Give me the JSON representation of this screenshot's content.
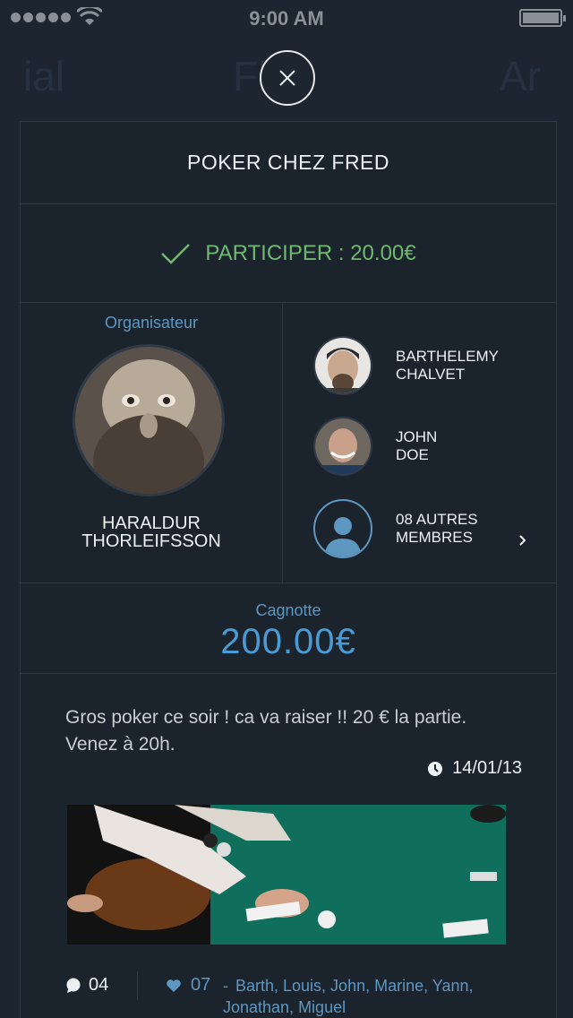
{
  "status_bar": {
    "time": "9:00 AM"
  },
  "background_nav": {
    "left": "ial",
    "center": "Fl  z",
    "right": "Ar"
  },
  "event": {
    "title": "POKER CHEZ FRED",
    "participate_label": "PARTICIPER : 20.00€",
    "organizer_label": "Organisateur",
    "organizer_name_line1": "HARALDUR",
    "organizer_name_line2": "THORLEIFSSON",
    "members": [
      {
        "line1": "BARTHELEMY",
        "line2": "CHALVET"
      },
      {
        "line1": "JOHN",
        "line2": "DOE"
      },
      {
        "line1": "08 AUTRES",
        "line2": "MEMBRES"
      }
    ],
    "pot_label": "Cagnotte",
    "pot_value": "200.00€",
    "message": "Gros poker ce soir ! ca va raiser !! 20 € la partie. Venez à 20h.",
    "date": "14/01/13",
    "comments_count": "04",
    "likes_count": "07",
    "likers": "Barth, Louis, John, Marine, Yann, Jonathan, Miguel"
  },
  "colors": {
    "background": "#1d2530",
    "accent_blue": "#5e97c0",
    "pot_blue": "#4a9ad4",
    "green": "#6fb96f"
  },
  "icons": [
    "signal-dots-icon",
    "wifi-icon",
    "battery-icon",
    "close-icon",
    "check-icon",
    "user-placeholder-icon",
    "chevron-right-icon",
    "clock-icon",
    "comment-icon",
    "heart-icon"
  ]
}
